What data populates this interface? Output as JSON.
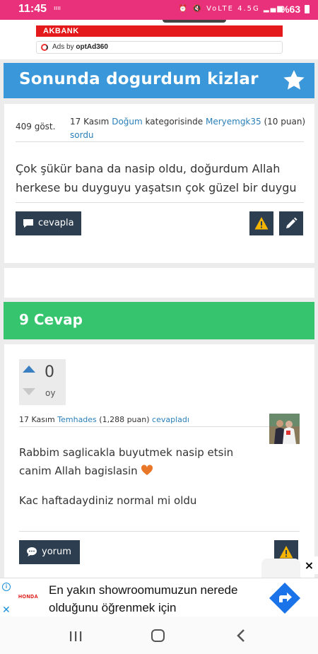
{
  "status_bar": {
    "time": "11:45",
    "mini_label": "ıııı",
    "network": "VoLTE 4.5G",
    "battery": "%63"
  },
  "ad_top": {
    "brand": "AKBANK",
    "ads_by_prefix": "Ads by",
    "ads_by_name": "optAd360"
  },
  "question": {
    "title": "Sonunda dogurdum kizlar",
    "views": "409 göst.",
    "date": "17 Kasım",
    "category": "Doğum",
    "category_suffix": "kategorisinde",
    "user": "Meryemgk35",
    "points": "(10 puan)",
    "action": "sordu",
    "text": "Çok şükür bana da nasip oldu, doğurdum Allah herkese bu duyguyu yaşatsın çok güzel bir duygu",
    "answer_button": "cevapla"
  },
  "answers_section": {
    "title": "9 Cevap"
  },
  "answer": {
    "vote_count": "0",
    "vote_label": "oy",
    "date": "17 Kasım",
    "user": "Temhades",
    "points": "(1,288 puan)",
    "action": "cevapladı",
    "line1": "Rabbim saglicakla buyutmek nasip etsin",
    "line2": "canim Allah bagislasin",
    "line3": "Kac haftadaydiniz normal mi oldu",
    "comment_button": "yorum"
  },
  "ad_bottom": {
    "brand": "HONDA",
    "text": "En yakın showroomumuzun nerede olduğunu öğrenmek için",
    "close": "×"
  },
  "colors": {
    "status_bar": "#e8317a",
    "question_header": "#3a97d9",
    "answers_header": "#36c46e",
    "dark_button": "#2d3e50",
    "warning": "#f4b400",
    "link": "#2a7fb8"
  }
}
